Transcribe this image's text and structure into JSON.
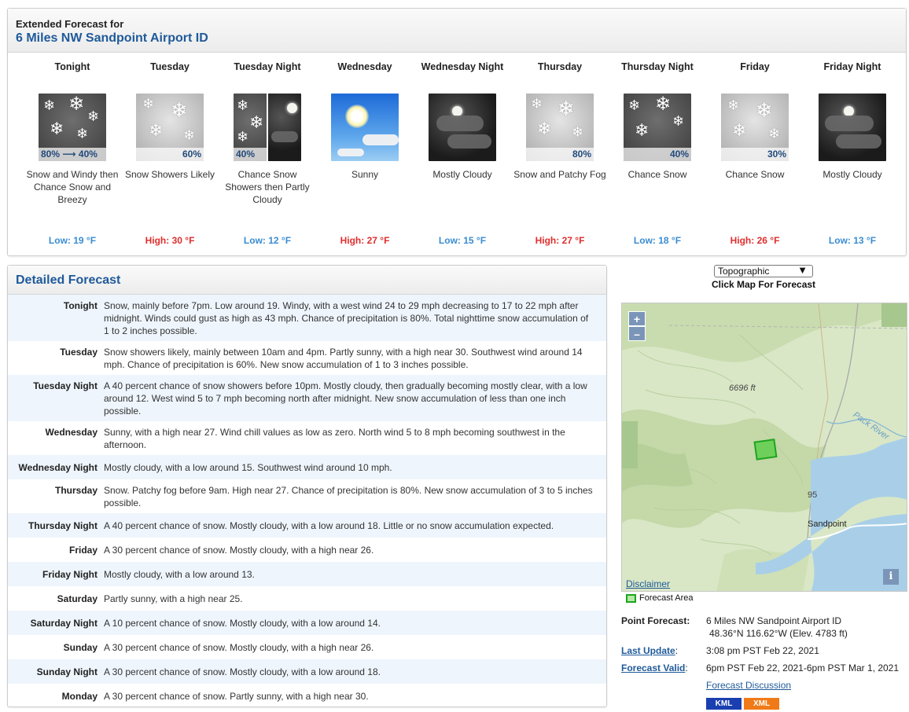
{
  "extended": {
    "kicker": "Extended Forecast for",
    "place": "6 Miles NW Sandpoint Airport ID",
    "periods": [
      {
        "name": "Tonight",
        "pop": "80% ⟶ 40%",
        "desc": "Snow and Windy then Chance Snow and Breezy",
        "temp": "Low: 19 °F",
        "kind": "low"
      },
      {
        "name": "Tuesday",
        "pop": "60%",
        "desc": "Snow Showers Likely",
        "temp": "High: 30 °F",
        "kind": "high"
      },
      {
        "name": "Tuesday Night",
        "pop": "40%",
        "desc": "Chance Snow Showers then Partly Cloudy",
        "temp": "Low: 12 °F",
        "kind": "low"
      },
      {
        "name": "Wednesday",
        "pop": "",
        "desc": "Sunny",
        "temp": "High: 27 °F",
        "kind": "high"
      },
      {
        "name": "Wednesday Night",
        "pop": "",
        "desc": "Mostly Cloudy",
        "temp": "Low: 15 °F",
        "kind": "low"
      },
      {
        "name": "Thursday",
        "pop": "80%",
        "desc": "Snow and Patchy Fog",
        "temp": "High: 27 °F",
        "kind": "high"
      },
      {
        "name": "Thursday Night",
        "pop": "40%",
        "desc": "Chance Snow",
        "temp": "Low: 18 °F",
        "kind": "low"
      },
      {
        "name": "Friday",
        "pop": "30%",
        "desc": "Chance Snow",
        "temp": "High: 26 °F",
        "kind": "high"
      },
      {
        "name": "Friday Night",
        "pop": "",
        "desc": "Mostly Cloudy",
        "temp": "Low: 13 °F",
        "kind": "low"
      }
    ]
  },
  "detailed": {
    "title": "Detailed Forecast",
    "rows": [
      {
        "label": "Tonight",
        "text": "Snow, mainly before 7pm. Low around 19. Windy, with a west wind 24 to 29 mph decreasing to 17 to 22 mph after midnight. Winds could gust as high as 43 mph. Chance of precipitation is 80%. Total nighttime snow accumulation of 1 to 2 inches possible."
      },
      {
        "label": "Tuesday",
        "text": "Snow showers likely, mainly between 10am and 4pm. Partly sunny, with a high near 30. Southwest wind around 14 mph. Chance of precipitation is 60%. New snow accumulation of 1 to 3 inches possible."
      },
      {
        "label": "Tuesday Night",
        "text": "A 40 percent chance of snow showers before 10pm. Mostly cloudy, then gradually becoming mostly clear, with a low around 12. West wind 5 to 7 mph becoming north after midnight. New snow accumulation of less than one inch possible."
      },
      {
        "label": "Wednesday",
        "text": "Sunny, with a high near 27. Wind chill values as low as zero. North wind 5 to 8 mph becoming southwest in the afternoon."
      },
      {
        "label": "Wednesday Night",
        "text": "Mostly cloudy, with a low around 15. Southwest wind around 10 mph."
      },
      {
        "label": "Thursday",
        "text": "Snow. Patchy fog before 9am. High near 27. Chance of precipitation is 80%. New snow accumulation of 3 to 5 inches possible."
      },
      {
        "label": "Thursday Night",
        "text": "A 40 percent chance of snow. Mostly cloudy, with a low around 18. Little or no snow accumulation expected."
      },
      {
        "label": "Friday",
        "text": "A 30 percent chance of snow. Mostly cloudy, with a high near 26."
      },
      {
        "label": "Friday Night",
        "text": "Mostly cloudy, with a low around 13."
      },
      {
        "label": "Saturday",
        "text": "Partly sunny, with a high near 25."
      },
      {
        "label": "Saturday Night",
        "text": "A 10 percent chance of snow. Mostly cloudy, with a low around 14."
      },
      {
        "label": "Sunday",
        "text": "A 30 percent chance of snow. Mostly cloudy, with a high near 26."
      },
      {
        "label": "Sunday Night",
        "text": "A 30 percent chance of snow. Mostly cloudy, with a low around 18."
      },
      {
        "label": "Monday",
        "text": "A 30 percent chance of snow. Partly sunny, with a high near 30."
      }
    ]
  },
  "map": {
    "select_value": "Topographic",
    "click_label": "Click Map For Forecast",
    "zoom_in": "+",
    "zoom_out": "–",
    "elevation_label": "6696 ft",
    "river_label": "Pack River",
    "town_label": "Sandpoint",
    "highway_label": "95",
    "info": "i",
    "disclaimer": "Disclaimer",
    "legend": "Forecast Area"
  },
  "meta": {
    "point_forecast_label": "Point Forecast:",
    "point_forecast_value": "6 Miles NW Sandpoint Airport ID",
    "coords": "48.36°N 116.62°W (Elev. 4783 ft)",
    "last_update_label": "Last Update",
    "last_update_value": "3:08 pm PST Feb 22, 2021",
    "valid_label": "Forecast Valid",
    "valid_value": "6pm PST Feb 22, 2021-6pm PST Mar 1, 2021",
    "discussion": "Forecast Discussion",
    "kml": "KML",
    "xml": "XML"
  },
  "colors": {
    "brand_blue": "#1f5a9a",
    "low_temp": "#3a8cd1",
    "high_temp": "#e02e2e",
    "kml_badge": "#1a3fb0",
    "xml_badge": "#f07a17"
  }
}
